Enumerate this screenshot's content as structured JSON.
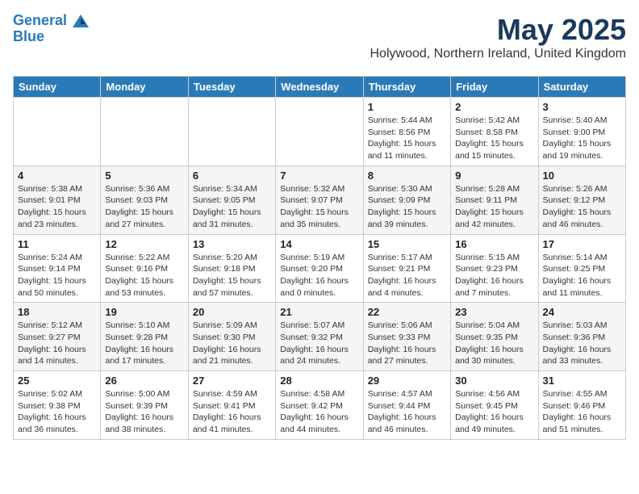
{
  "header": {
    "logo_line1": "General",
    "logo_line2": "Blue",
    "month_title": "May 2025",
    "subtitle": "Holywood, Northern Ireland, United Kingdom"
  },
  "weekdays": [
    "Sunday",
    "Monday",
    "Tuesday",
    "Wednesday",
    "Thursday",
    "Friday",
    "Saturday"
  ],
  "weeks": [
    [
      {
        "day": "",
        "info": ""
      },
      {
        "day": "",
        "info": ""
      },
      {
        "day": "",
        "info": ""
      },
      {
        "day": "",
        "info": ""
      },
      {
        "day": "1",
        "info": "Sunrise: 5:44 AM\nSunset: 8:56 PM\nDaylight: 15 hours\nand 11 minutes."
      },
      {
        "day": "2",
        "info": "Sunrise: 5:42 AM\nSunset: 8:58 PM\nDaylight: 15 hours\nand 15 minutes."
      },
      {
        "day": "3",
        "info": "Sunrise: 5:40 AM\nSunset: 9:00 PM\nDaylight: 15 hours\nand 19 minutes."
      }
    ],
    [
      {
        "day": "4",
        "info": "Sunrise: 5:38 AM\nSunset: 9:01 PM\nDaylight: 15 hours\nand 23 minutes."
      },
      {
        "day": "5",
        "info": "Sunrise: 5:36 AM\nSunset: 9:03 PM\nDaylight: 15 hours\nand 27 minutes."
      },
      {
        "day": "6",
        "info": "Sunrise: 5:34 AM\nSunset: 9:05 PM\nDaylight: 15 hours\nand 31 minutes."
      },
      {
        "day": "7",
        "info": "Sunrise: 5:32 AM\nSunset: 9:07 PM\nDaylight: 15 hours\nand 35 minutes."
      },
      {
        "day": "8",
        "info": "Sunrise: 5:30 AM\nSunset: 9:09 PM\nDaylight: 15 hours\nand 39 minutes."
      },
      {
        "day": "9",
        "info": "Sunrise: 5:28 AM\nSunset: 9:11 PM\nDaylight: 15 hours\nand 42 minutes."
      },
      {
        "day": "10",
        "info": "Sunrise: 5:26 AM\nSunset: 9:12 PM\nDaylight: 15 hours\nand 46 minutes."
      }
    ],
    [
      {
        "day": "11",
        "info": "Sunrise: 5:24 AM\nSunset: 9:14 PM\nDaylight: 15 hours\nand 50 minutes."
      },
      {
        "day": "12",
        "info": "Sunrise: 5:22 AM\nSunset: 9:16 PM\nDaylight: 15 hours\nand 53 minutes."
      },
      {
        "day": "13",
        "info": "Sunrise: 5:20 AM\nSunset: 9:18 PM\nDaylight: 15 hours\nand 57 minutes."
      },
      {
        "day": "14",
        "info": "Sunrise: 5:19 AM\nSunset: 9:20 PM\nDaylight: 16 hours\nand 0 minutes."
      },
      {
        "day": "15",
        "info": "Sunrise: 5:17 AM\nSunset: 9:21 PM\nDaylight: 16 hours\nand 4 minutes."
      },
      {
        "day": "16",
        "info": "Sunrise: 5:15 AM\nSunset: 9:23 PM\nDaylight: 16 hours\nand 7 minutes."
      },
      {
        "day": "17",
        "info": "Sunrise: 5:14 AM\nSunset: 9:25 PM\nDaylight: 16 hours\nand 11 minutes."
      }
    ],
    [
      {
        "day": "18",
        "info": "Sunrise: 5:12 AM\nSunset: 9:27 PM\nDaylight: 16 hours\nand 14 minutes."
      },
      {
        "day": "19",
        "info": "Sunrise: 5:10 AM\nSunset: 9:28 PM\nDaylight: 16 hours\nand 17 minutes."
      },
      {
        "day": "20",
        "info": "Sunrise: 5:09 AM\nSunset: 9:30 PM\nDaylight: 16 hours\nand 21 minutes."
      },
      {
        "day": "21",
        "info": "Sunrise: 5:07 AM\nSunset: 9:32 PM\nDaylight: 16 hours\nand 24 minutes."
      },
      {
        "day": "22",
        "info": "Sunrise: 5:06 AM\nSunset: 9:33 PM\nDaylight: 16 hours\nand 27 minutes."
      },
      {
        "day": "23",
        "info": "Sunrise: 5:04 AM\nSunset: 9:35 PM\nDaylight: 16 hours\nand 30 minutes."
      },
      {
        "day": "24",
        "info": "Sunrise: 5:03 AM\nSunset: 9:36 PM\nDaylight: 16 hours\nand 33 minutes."
      }
    ],
    [
      {
        "day": "25",
        "info": "Sunrise: 5:02 AM\nSunset: 9:38 PM\nDaylight: 16 hours\nand 36 minutes."
      },
      {
        "day": "26",
        "info": "Sunrise: 5:00 AM\nSunset: 9:39 PM\nDaylight: 16 hours\nand 38 minutes."
      },
      {
        "day": "27",
        "info": "Sunrise: 4:59 AM\nSunset: 9:41 PM\nDaylight: 16 hours\nand 41 minutes."
      },
      {
        "day": "28",
        "info": "Sunrise: 4:58 AM\nSunset: 9:42 PM\nDaylight: 16 hours\nand 44 minutes."
      },
      {
        "day": "29",
        "info": "Sunrise: 4:57 AM\nSunset: 9:44 PM\nDaylight: 16 hours\nand 46 minutes."
      },
      {
        "day": "30",
        "info": "Sunrise: 4:56 AM\nSunset: 9:45 PM\nDaylight: 16 hours\nand 49 minutes."
      },
      {
        "day": "31",
        "info": "Sunrise: 4:55 AM\nSunset: 9:46 PM\nDaylight: 16 hours\nand 51 minutes."
      }
    ]
  ]
}
